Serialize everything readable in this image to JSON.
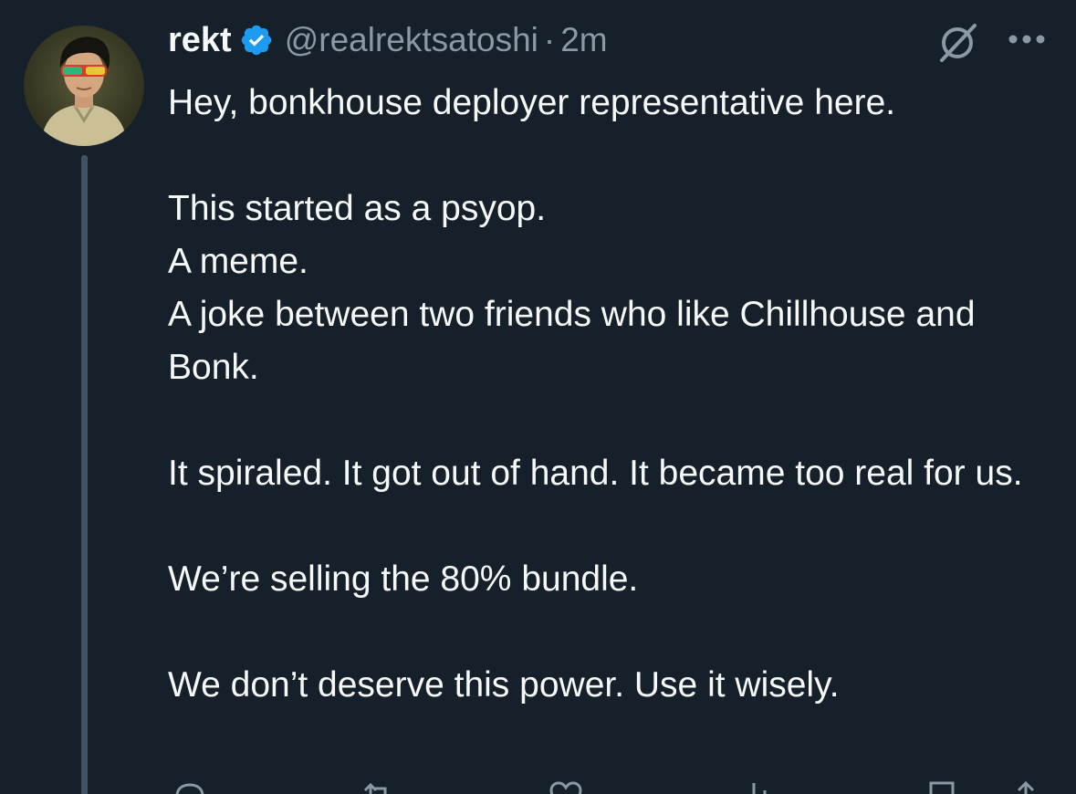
{
  "author": {
    "display_name": "rekt",
    "handle": "@realrektsatoshi",
    "separator": "·",
    "time": "2m",
    "verified": true
  },
  "tweet": {
    "paragraphs": [
      "Hey, bonkhouse deployer representative here.",
      "This started as a psyop.\nA meme.\nA joke between two friends who like Chillhouse and Bonk.",
      "It spiraled. It got out of hand. It became too real for us.",
      "We’re selling the 80% bundle.",
      "We don’t deserve this power. Use it wisely."
    ]
  },
  "icons": {
    "verified": "verified-badge-icon",
    "grok": "grok-icon",
    "more": "more-icon",
    "reply": "reply-icon",
    "retweet": "retweet-icon",
    "like": "like-icon",
    "views": "views-icon",
    "bookmark": "bookmark-icon",
    "share": "share-icon"
  },
  "colors": {
    "background": "#15202b",
    "text": "#f7f9f9",
    "secondary": "#8b98a5",
    "verified": "#1d9bf0",
    "thread_line": "#3d5466"
  }
}
